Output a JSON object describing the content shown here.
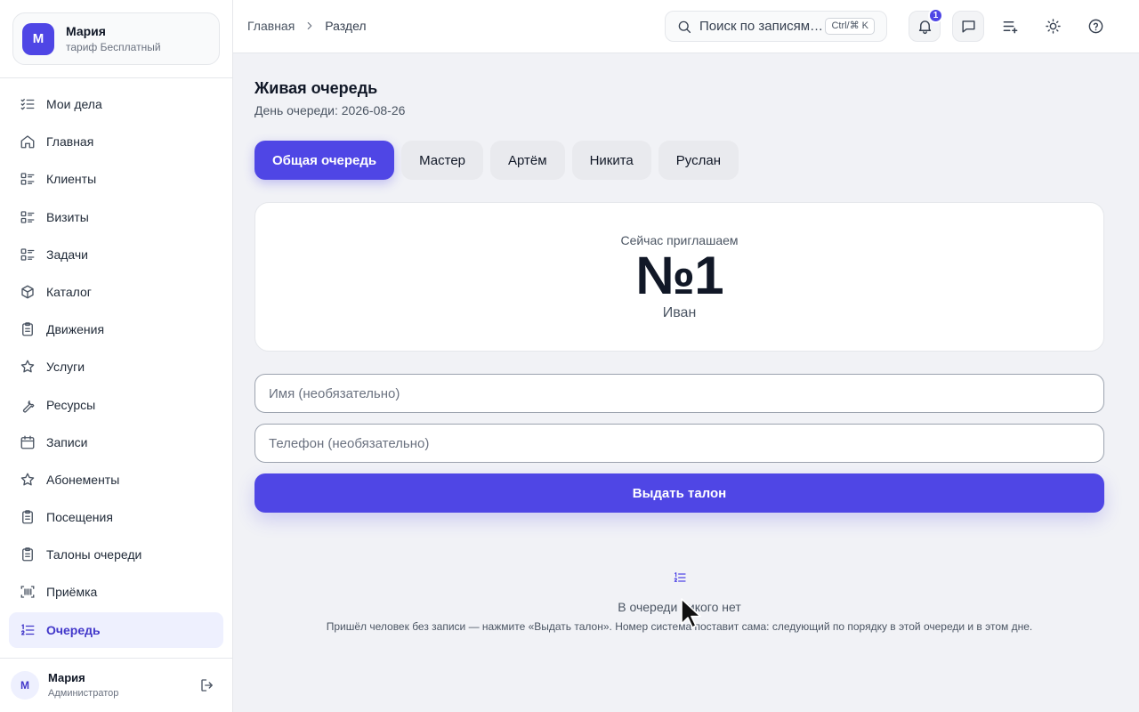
{
  "org": {
    "avatar_letter": "М",
    "name": "Мария",
    "plan": "тариф Бесплатный"
  },
  "sidebar": {
    "items": [
      {
        "label": "Мои дела",
        "icon": "checklist-icon"
      },
      {
        "label": "Главная",
        "icon": "home-icon"
      },
      {
        "label": "Клиенты",
        "icon": "list-icon"
      },
      {
        "label": "Визиты",
        "icon": "list-icon"
      },
      {
        "label": "Задачи",
        "icon": "list-icon"
      },
      {
        "label": "Каталог",
        "icon": "box-icon"
      },
      {
        "label": "Движения",
        "icon": "clipboard-icon"
      },
      {
        "label": "Услуги",
        "icon": "star-icon"
      },
      {
        "label": "Ресурсы",
        "icon": "wrench-icon"
      },
      {
        "label": "Записи",
        "icon": "calendar-icon"
      },
      {
        "label": "Абонементы",
        "icon": "star-icon"
      },
      {
        "label": "Посещения",
        "icon": "clipboard-icon"
      },
      {
        "label": "Талоны очереди",
        "icon": "clipboard-icon"
      },
      {
        "label": "Приёмка",
        "icon": "barcode-scan-icon"
      },
      {
        "label": "Очередь",
        "icon": "numbered-list-icon",
        "active": true
      }
    ]
  },
  "user": {
    "avatar_letter": "М",
    "name": "Мария",
    "role": "Администратор"
  },
  "breadcrumb": {
    "home": "Главная",
    "current": "Раздел"
  },
  "search": {
    "placeholder": "Поиск по записям…",
    "shortcut": "Ctrl/⌘ K"
  },
  "notifications": {
    "count": "1"
  },
  "page": {
    "title": "Живая очередь",
    "subtitle": "День очереди: 2026-08-26"
  },
  "tabs": [
    {
      "label": "Общая очередь",
      "active": true
    },
    {
      "label": "Мастер"
    },
    {
      "label": "Артём"
    },
    {
      "label": "Никита"
    },
    {
      "label": "Руслан"
    }
  ],
  "now_serving": {
    "label": "Сейчас приглашаем",
    "number": "№1",
    "name": "Иван"
  },
  "form": {
    "name_placeholder": "Имя (необязательно)",
    "phone_placeholder": "Телефон (необязательно)",
    "submit_label": "Выдать талон"
  },
  "empty_state": {
    "title": "В очереди никого нет",
    "hint": "Пришёл человек без записи — нажмите «Выдать талон». Номер система поставит сама: следующий по порядку в этой очереди и в этом дне."
  },
  "colors": {
    "accent": "#4f46e5",
    "active_bg": "#eef0fe",
    "main_bg": "#f1f2f6"
  }
}
